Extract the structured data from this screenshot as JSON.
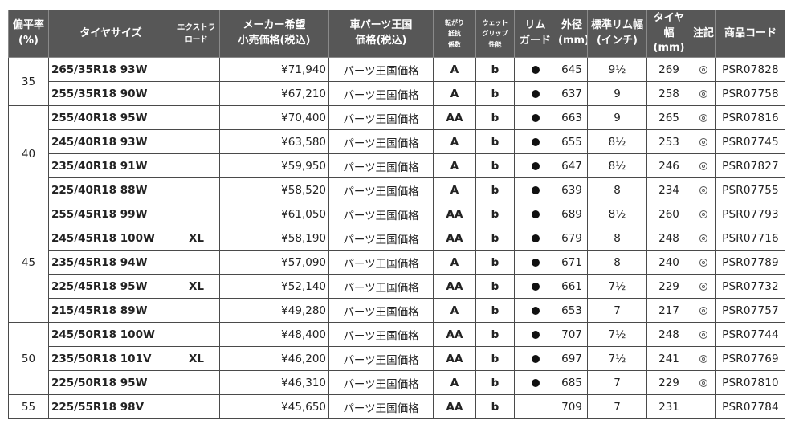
{
  "headers": {
    "aspect": [
      "偏平率",
      "(%)"
    ],
    "size": "タイヤサイズ",
    "xl": [
      "エクストラ",
      "ロード"
    ],
    "maker_price": [
      "メーカー希望",
      "小売価格(税込)"
    ],
    "shop_price": [
      "車パーツ王国",
      "価格(税込)"
    ],
    "rolling": [
      "転がり",
      "抵抗",
      "係数"
    ],
    "wet": [
      "ウェット",
      "グリップ",
      "性能"
    ],
    "rim_guard": [
      "リム",
      "ガード"
    ],
    "diameter": [
      "外径",
      "(mm)"
    ],
    "rim_width": [
      "標準リム幅",
      "(インチ)"
    ],
    "tire_width": [
      "タイヤ幅",
      "(mm)"
    ],
    "note": "注記",
    "code": "商品コード"
  },
  "shop_price_label": "パーツ王国価格",
  "groups": [
    {
      "aspect": "35",
      "rows": [
        {
          "size": "265/35R18 93W",
          "xl": "",
          "price": "¥71,940",
          "rolling": "A",
          "wet": "b",
          "rim_guard": true,
          "diameter": "645",
          "rim_width": "9½",
          "tire_width": "269",
          "note": true,
          "code": "PSR07828"
        },
        {
          "size": "255/35R18 90W",
          "xl": "",
          "price": "¥67,210",
          "rolling": "A",
          "wet": "b",
          "rim_guard": true,
          "diameter": "637",
          "rim_width": "9",
          "tire_width": "258",
          "note": true,
          "code": "PSR07758"
        }
      ]
    },
    {
      "aspect": "40",
      "rows": [
        {
          "size": "255/40R18 95W",
          "xl": "",
          "price": "¥70,400",
          "rolling": "AA",
          "wet": "b",
          "rim_guard": true,
          "diameter": "663",
          "rim_width": "9",
          "tire_width": "265",
          "note": true,
          "code": "PSR07816"
        },
        {
          "size": "245/40R18 93W",
          "xl": "",
          "price": "¥63,580",
          "rolling": "A",
          "wet": "b",
          "rim_guard": true,
          "diameter": "655",
          "rim_width": "8½",
          "tire_width": "253",
          "note": true,
          "code": "PSR07745"
        },
        {
          "size": "235/40R18 91W",
          "xl": "",
          "price": "¥59,950",
          "rolling": "A",
          "wet": "b",
          "rim_guard": true,
          "diameter": "647",
          "rim_width": "8½",
          "tire_width": "246",
          "note": true,
          "code": "PSR07827"
        },
        {
          "size": "225/40R18 88W",
          "xl": "",
          "price": "¥58,520",
          "rolling": "A",
          "wet": "b",
          "rim_guard": true,
          "diameter": "639",
          "rim_width": "8",
          "tire_width": "234",
          "note": true,
          "code": "PSR07755"
        }
      ]
    },
    {
      "aspect": "45",
      "rows": [
        {
          "size": "255/45R18 99W",
          "xl": "",
          "price": "¥61,050",
          "rolling": "AA",
          "wet": "b",
          "rim_guard": true,
          "diameter": "689",
          "rim_width": "8½",
          "tire_width": "260",
          "note": true,
          "code": "PSR07793"
        },
        {
          "size": "245/45R18 100W",
          "xl": "XL",
          "price": "¥58,190",
          "rolling": "AA",
          "wet": "b",
          "rim_guard": true,
          "diameter": "679",
          "rim_width": "8",
          "tire_width": "248",
          "note": true,
          "code": "PSR07716"
        },
        {
          "size": "235/45R18 94W",
          "xl": "",
          "price": "¥57,090",
          "rolling": "A",
          "wet": "b",
          "rim_guard": true,
          "diameter": "671",
          "rim_width": "8",
          "tire_width": "240",
          "note": true,
          "code": "PSR07789"
        },
        {
          "size": "225/45R18 95W",
          "xl": "XL",
          "price": "¥52,140",
          "rolling": "AA",
          "wet": "b",
          "rim_guard": true,
          "diameter": "661",
          "rim_width": "7½",
          "tire_width": "229",
          "note": true,
          "code": "PSR07732"
        },
        {
          "size": "215/45R18 89W",
          "xl": "",
          "price": "¥49,280",
          "rolling": "A",
          "wet": "b",
          "rim_guard": true,
          "diameter": "653",
          "rim_width": "7",
          "tire_width": "217",
          "note": true,
          "code": "PSR07757"
        }
      ]
    },
    {
      "aspect": "50",
      "rows": [
        {
          "size": "245/50R18 100W",
          "xl": "",
          "price": "¥48,400",
          "rolling": "AA",
          "wet": "b",
          "rim_guard": true,
          "diameter": "707",
          "rim_width": "7½",
          "tire_width": "248",
          "note": true,
          "code": "PSR07744"
        },
        {
          "size": "235/50R18 101V",
          "xl": "XL",
          "price": "¥46,200",
          "rolling": "AA",
          "wet": "b",
          "rim_guard": true,
          "diameter": "697",
          "rim_width": "7½",
          "tire_width": "241",
          "note": true,
          "code": "PSR07769"
        },
        {
          "size": "225/50R18 95W",
          "xl": "",
          "price": "¥46,310",
          "rolling": "A",
          "wet": "b",
          "rim_guard": true,
          "diameter": "685",
          "rim_width": "7",
          "tire_width": "229",
          "note": true,
          "code": "PSR07810"
        }
      ]
    },
    {
      "aspect": "55",
      "rows": [
        {
          "size": "225/55R18 98V",
          "xl": "",
          "price": "¥45,650",
          "rolling": "AA",
          "wet": "b",
          "rim_guard": false,
          "diameter": "709",
          "rim_width": "7",
          "tire_width": "231",
          "note": false,
          "code": "PSR07784"
        }
      ]
    }
  ],
  "icons": {
    "rim_guard": "filled-circle-icon",
    "note": "double-circle-icon"
  },
  "colors": {
    "header_bg": "#575757",
    "size_text": "#1a6aa8",
    "shop_price_text": "#e02020",
    "grade_text": "#15a315"
  }
}
